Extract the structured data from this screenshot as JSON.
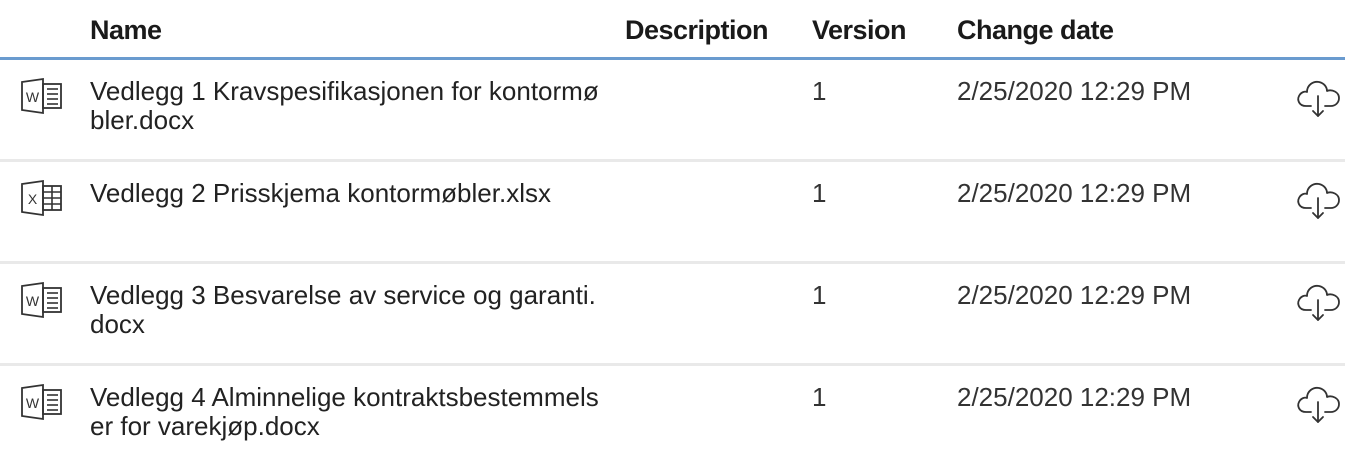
{
  "table": {
    "columns": {
      "name": "Name",
      "description": "Description",
      "version": "Version",
      "change_date": "Change date"
    },
    "rows": [
      {
        "file_type": "word",
        "icon": "word-document-icon",
        "icon_letter": "W",
        "name": "Vedlegg 1 Kravspesifikasjonen for kontormøbler.docx",
        "description": "",
        "version": "1",
        "change_date": "2/25/2020 12:29 PM",
        "action_icon": "cloud-download-icon"
      },
      {
        "file_type": "excel",
        "icon": "excel-spreadsheet-icon",
        "icon_letter": "X",
        "name": "Vedlegg 2 Prisskjema kontormøbler.xlsx",
        "description": "",
        "version": "1",
        "change_date": "2/25/2020 12:29 PM",
        "action_icon": "cloud-download-icon"
      },
      {
        "file_type": "word",
        "icon": "word-document-icon",
        "icon_letter": "W",
        "name": "Vedlegg 3 Besvarelse av service og garanti.docx",
        "description": "",
        "version": "1",
        "change_date": "2/25/2020 12:29 PM",
        "action_icon": "cloud-download-icon"
      },
      {
        "file_type": "word",
        "icon": "word-document-icon",
        "icon_letter": "W",
        "name": "Vedlegg 4 Alminnelige kontraktsbestemmelser for varekjøp.docx",
        "description": "",
        "version": "1",
        "change_date": "2/25/2020 12:29 PM",
        "action_icon": "cloud-download-icon"
      }
    ]
  },
  "colors": {
    "header_underline": "#6a9bcf",
    "row_divider": "#e9e9e9",
    "icon_stroke": "#333333"
  }
}
